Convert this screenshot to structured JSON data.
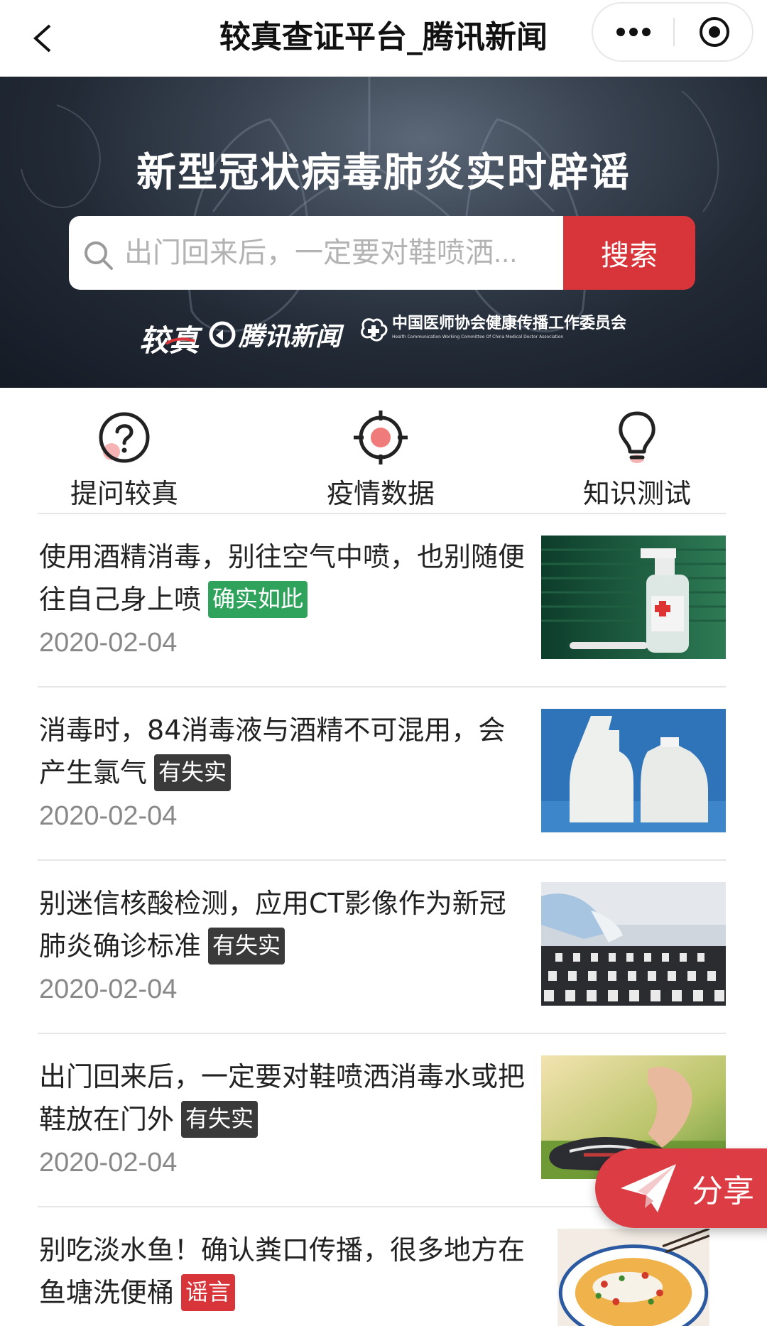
{
  "topbar": {
    "title": "较真查证平台_腾讯新闻",
    "back_icon": "chevron-left-icon",
    "more_icon": "more-dots-icon",
    "close_icon": "target-icon"
  },
  "hero": {
    "title": "新型冠状病毒肺炎实时辟谣",
    "search_placeholder": "出门回来后，一定要对鞋喷洒...",
    "search_button": "搜索",
    "logos": {
      "jiaozhen": "较真",
      "tencent": "腾讯新闻",
      "cmda_cn": "中国医师协会健康传播工作委员会",
      "cmda_en": "Health Communication Working Committee Of China Medical Doctor Association"
    }
  },
  "quicknav": [
    {
      "label": "提问较真",
      "icon": "question-circle-icon"
    },
    {
      "label": "疫情数据",
      "icon": "crosshair-icon"
    },
    {
      "label": "知识测试",
      "icon": "lightbulb-icon"
    }
  ],
  "articles": [
    {
      "title": "使用酒精消毒，别往空气中喷，也别随便往自己身上喷",
      "tag": "确实如此",
      "tag_color": "#2fa35c",
      "date": "2020-02-04",
      "image": "alcohol-spray-bottle"
    },
    {
      "title": "消毒时，84消毒液与酒精不可混用，会产生氯气",
      "tag": "有失实",
      "tag_color": "#3a3a3a",
      "date": "2020-02-04",
      "image": "white-spray-bottles"
    },
    {
      "title": "别迷信核酸检测，应用CT影像作为新冠肺炎确诊标准",
      "tag": "有失实",
      "tag_color": "#3a3a3a",
      "date": "2020-02-04",
      "image": "lab-test-tubes"
    },
    {
      "title": "出门回来后，一定要对鞋喷洒消毒水或把鞋放在门外",
      "tag": "有失实",
      "tag_color": "#3a3a3a",
      "date": "2020-02-04",
      "image": "shoe-on-grass"
    },
    {
      "title": "别吃淡水鱼！确认粪口传播，很多地方在鱼塘洗便桶",
      "tag": "谣言",
      "tag_color": "#d8353b",
      "date": "",
      "image": "fish-dish"
    }
  ],
  "share": {
    "label": "分享",
    "icon": "paper-plane-icon"
  },
  "colors": {
    "accent_red": "#d8353b",
    "true_green": "#2fa35c",
    "false_dark": "#3a3a3a"
  }
}
